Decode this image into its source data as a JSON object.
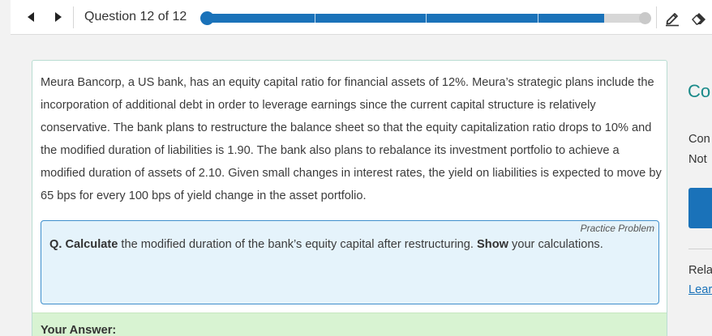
{
  "toolbar": {
    "prev_icon": "triangle-left-icon",
    "next_icon": "triangle-right-icon",
    "question_counter": "Question 12 of 12",
    "progress": 0.9,
    "progress_segments": 4,
    "pen_icon": "pen-icon",
    "eraser_icon": "eraser-icon",
    "accent_color": "#1a72b9"
  },
  "case": {
    "text": "Meura Bancorp, a US bank, has an equity capital ratio for financial assets of 12%. Meura’s strategic plans include the incorporation of additional debt in order to leverage earnings since the current capital structure is relatively conservative. The bank plans to restructure the balance sheet so that the equity capitalization ratio drops to 10% and the modified duration of liabilities is 1.90. The bank also plans to rebalance its investment portfolio to achieve a modified duration of assets of 2.10. Given small changes in interest rates, the yield on liabilities is expected to move by 65 bps for every 100 bps of yield change in the asset portfolio."
  },
  "problem": {
    "label": "Practice Problem",
    "q_prefix": "Q.",
    "verb1": "Calculate",
    "text_mid": "the modified duration of the bank’s equity capital after restructuring.",
    "verb2": "Show",
    "text_end": "your calculations."
  },
  "answer": {
    "label": "Your Answer:"
  },
  "right_panel": {
    "heading": "Co",
    "line1": "Con",
    "line2": "Not",
    "related": "Rela",
    "link": "Lear",
    "heading_color": "#1a8a89"
  }
}
